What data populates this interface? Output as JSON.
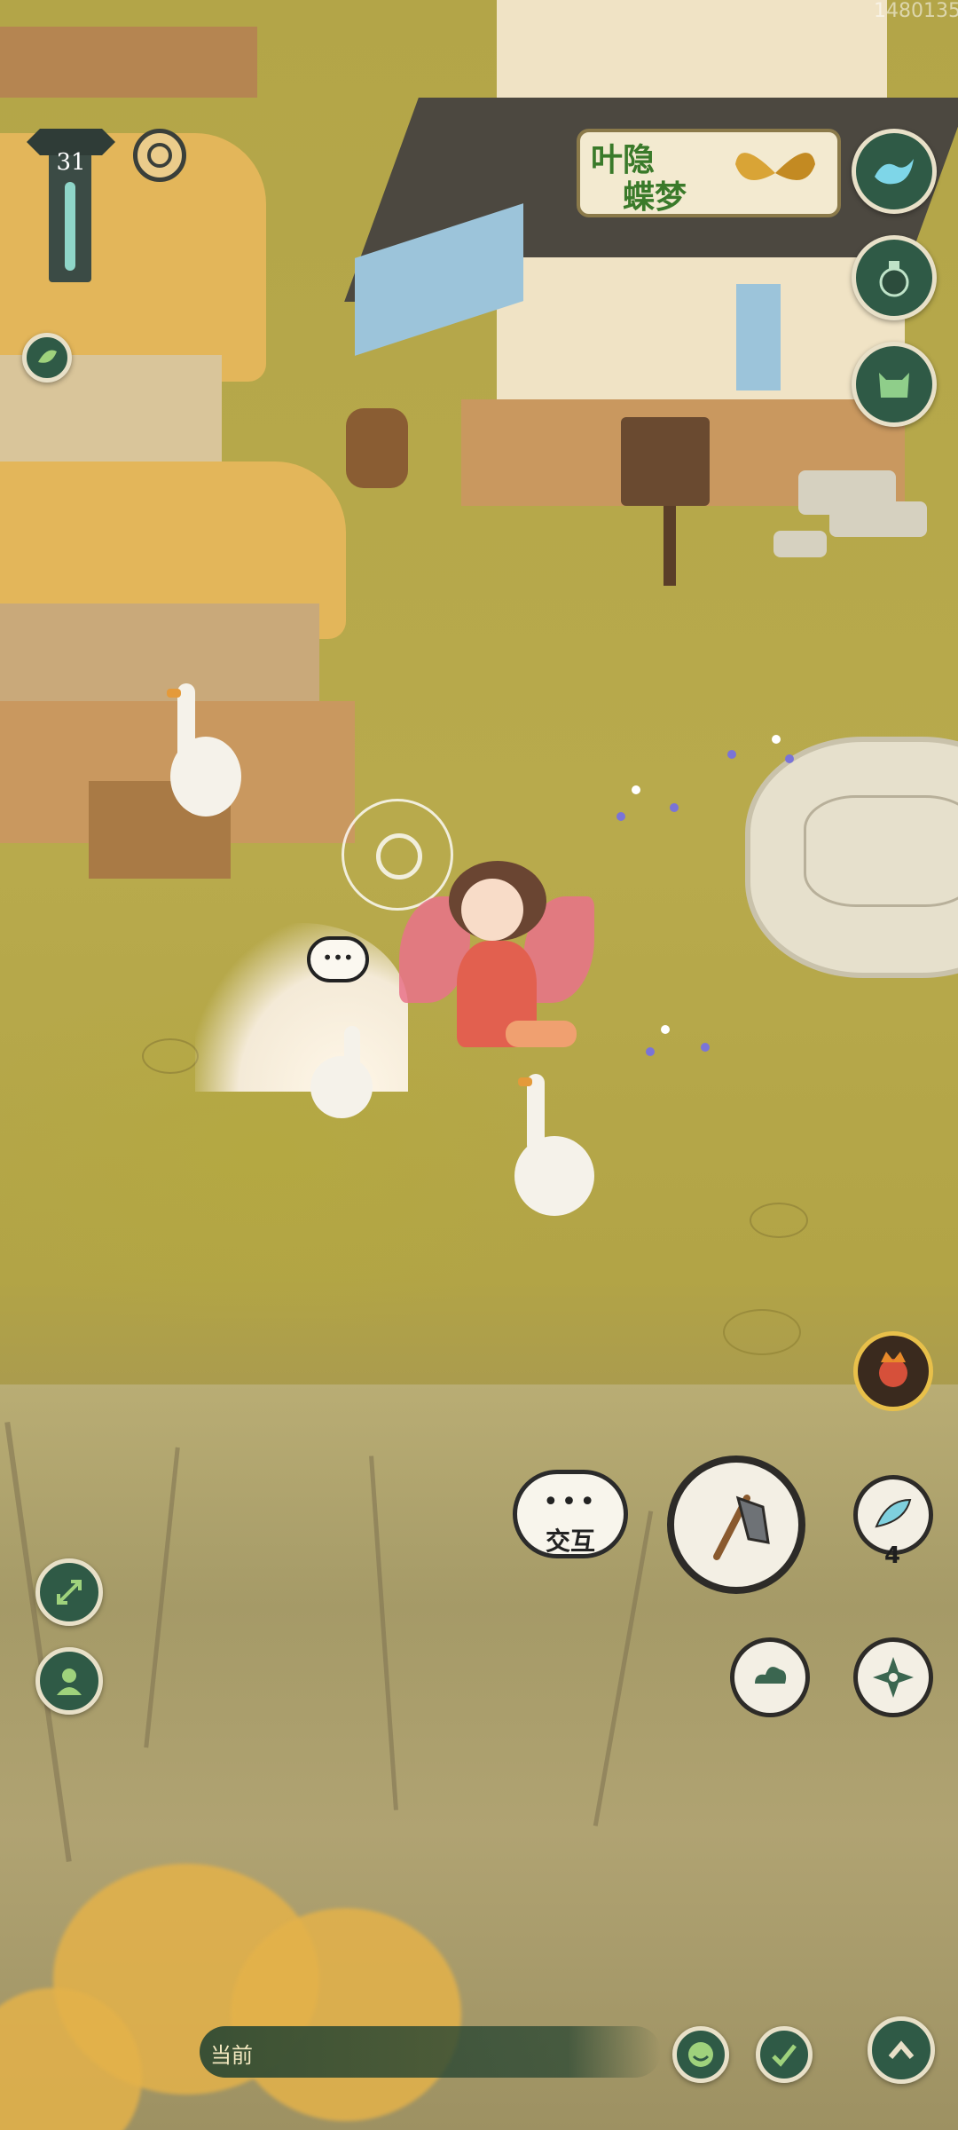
{
  "watermark": "1480135",
  "hud": {
    "level": "31",
    "banner_line1": "叶隐",
    "banner_line2": "蝶梦",
    "interact_label": "交互",
    "interact_dots": "•••",
    "npc_bubble_dots": "•••",
    "item_count": "4",
    "chat_label": "当前"
  },
  "colors": {
    "grass": "#b3a548",
    "hud_green": "#2f5a46",
    "banner_text": "#3a7a2a"
  },
  "icons": [
    "wave-icon",
    "potion-icon",
    "monster-icon",
    "leaf-icon",
    "expand-icon",
    "friend-icon",
    "axe-icon",
    "feather-icon",
    "cloud-icon",
    "shuriken-icon",
    "smile-icon",
    "mark-icon",
    "chevron-up-icon",
    "compass-icon",
    "fire-spirit-icon"
  ]
}
